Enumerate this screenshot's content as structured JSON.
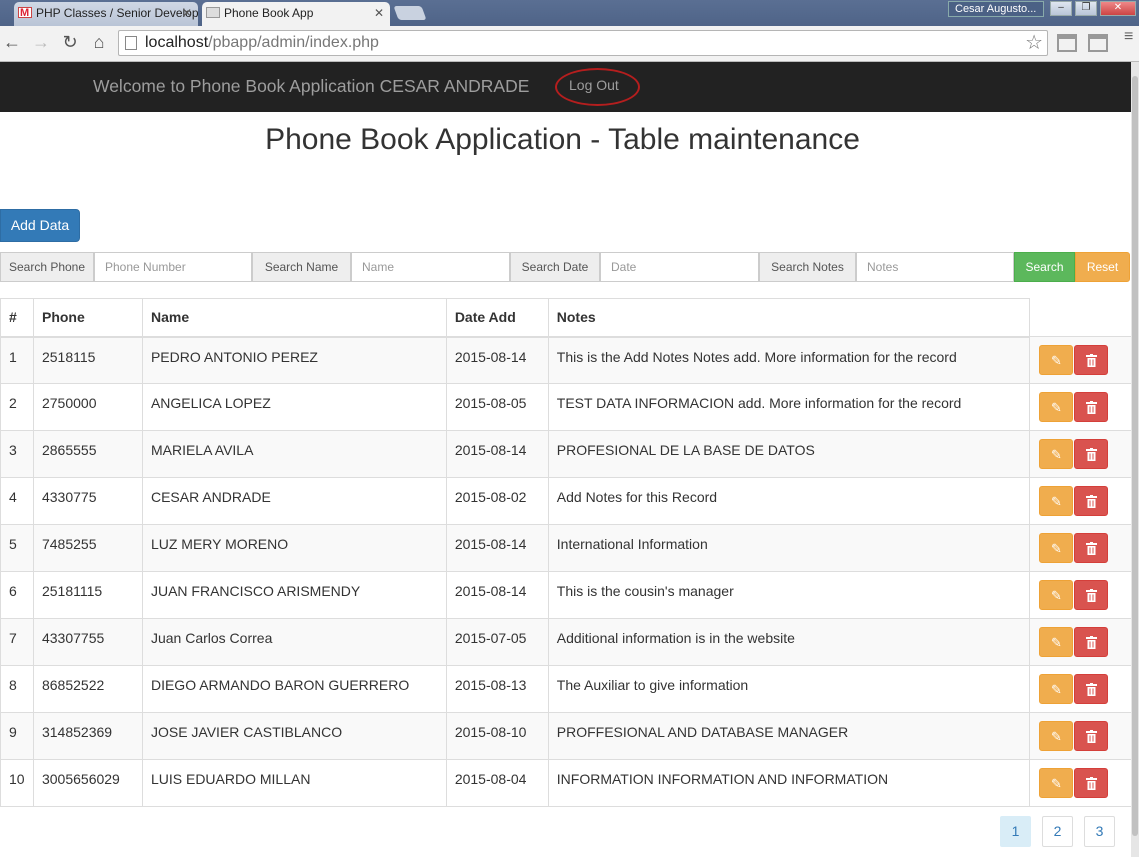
{
  "browser": {
    "tabs": [
      {
        "title": "PHP Classes / Senior Develop",
        "close": "✕"
      },
      {
        "title": "Phone Book App",
        "close": "✕"
      }
    ],
    "user_badge": "Cesar Augusto...",
    "window_buttons": [
      "‒",
      "❐",
      "✕"
    ],
    "url_host": "localhost",
    "url_path": "/pbapp/admin/index.php",
    "nav_icons": {
      "back": "back-arrow-icon",
      "forward": "forward-arrow-icon",
      "reload": "reload-icon",
      "home": "home-icon",
      "star": "bookmark-star-icon"
    }
  },
  "navbar": {
    "welcome": "Welcome to Phone Book Application CESAR ANDRADE",
    "logout_label": "Log Out",
    "highlight_color": "#b51e1e"
  },
  "page": {
    "title": "Phone Book Application - Table maintenance",
    "add_data_label": "Add Data"
  },
  "search": {
    "phone_label": "Search Phone",
    "phone_placeholder": "Phone Number",
    "name_label": "Search Name",
    "name_placeholder": "Name",
    "date_label": "Search Date",
    "date_placeholder": "Date",
    "notes_label": "Search Notes",
    "notes_placeholder": "Notes",
    "search_label": "Search",
    "reset_label": "Reset"
  },
  "table": {
    "headers": {
      "num": "#",
      "phone": "Phone",
      "name": "Name",
      "date": "Date Add",
      "notes": "Notes"
    },
    "rows": [
      {
        "num": "1",
        "phone": "2518115",
        "name": "PEDRO ANTONIO PEREZ",
        "date": "2015-08-14",
        "notes": "This is the Add Notes Notes add. More information for the record"
      },
      {
        "num": "2",
        "phone": "2750000",
        "name": "ANGELICA LOPEZ",
        "date": "2015-08-05",
        "notes": "TEST DATA INFORMACION add. More information for the record"
      },
      {
        "num": "3",
        "phone": "2865555",
        "name": "MARIELA AVILA",
        "date": "2015-08-14",
        "notes": "PROFESIONAL DE LA BASE DE DATOS"
      },
      {
        "num": "4",
        "phone": "4330775",
        "name": "CESAR ANDRADE",
        "date": "2015-08-02",
        "notes": "Add Notes for this Record"
      },
      {
        "num": "5",
        "phone": "7485255",
        "name": "LUZ MERY MORENO",
        "date": "2015-08-14",
        "notes": "International Information"
      },
      {
        "num": "6",
        "phone": "25181115",
        "name": "JUAN FRANCISCO ARISMENDY",
        "date": "2015-08-14",
        "notes": "This is the cousin's manager"
      },
      {
        "num": "7",
        "phone": "43307755",
        "name": "Juan Carlos Correa",
        "date": "2015-07-05",
        "notes": "Additional information is in the website"
      },
      {
        "num": "8",
        "phone": "86852522",
        "name": "DIEGO ARMANDO BARON GUERRERO",
        "date": "2015-08-13",
        "notes": "The Auxiliar to give information"
      },
      {
        "num": "9",
        "phone": "314852369",
        "name": "JOSE JAVIER CASTIBLANCO",
        "date": "2015-08-10",
        "notes": "PROFFESIONAL AND DATABASE MANAGER"
      },
      {
        "num": "10",
        "phone": "3005656029",
        "name": "LUIS EDUARDO MILLAN",
        "date": "2015-08-04",
        "notes": "INFORMATION INFORMATION AND INFORMATION"
      }
    ],
    "action_icons": {
      "edit": "pencil-icon",
      "delete": "trash-icon"
    }
  },
  "pagination": {
    "pages": [
      "1",
      "2",
      "3"
    ],
    "current": "1"
  },
  "colors": {
    "primary": "#337ab7",
    "success": "#5cb85c",
    "warning": "#f0ad4e",
    "danger": "#d9534f",
    "navbar": "#222222"
  }
}
